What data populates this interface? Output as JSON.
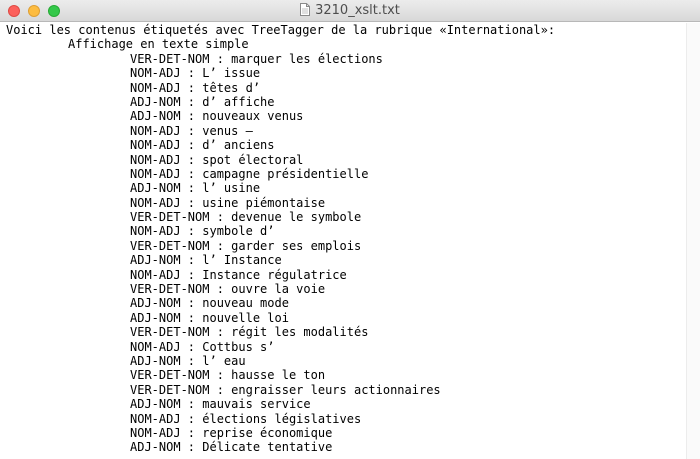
{
  "window": {
    "title": "3210_xslt.txt"
  },
  "document": {
    "intro": "Voici les contenus étiquetés avec TreeTagger de la rubrique «International»:",
    "section_heading": "Affichage en texte simple",
    "entries": [
      "VER-DET-NOM : marquer les élections",
      "NOM-ADJ : L’ issue",
      "NOM-ADJ : têtes d’",
      "ADJ-NOM : d’ affiche",
      "ADJ-NOM : nouveaux venus",
      "NOM-ADJ : venus –",
      "NOM-ADJ : d’ anciens",
      "NOM-ADJ : spot électoral",
      "NOM-ADJ : campagne présidentielle",
      "ADJ-NOM : l’ usine",
      "NOM-ADJ : usine piémontaise",
      "VER-DET-NOM : devenue le symbole",
      "NOM-ADJ : symbole d’",
      "VER-DET-NOM : garder ses emplois",
      "ADJ-NOM : l’ Instance",
      "NOM-ADJ : Instance régulatrice",
      "VER-DET-NOM : ouvre la voie",
      "ADJ-NOM : nouveau mode",
      "ADJ-NOM : nouvelle loi",
      "VER-DET-NOM : régit les modalités",
      "NOM-ADJ : Cottbus s’",
      "ADJ-NOM : l’ eau",
      "VER-DET-NOM : hausse le ton",
      "VER-DET-NOM : engraisser leurs actionnaires",
      "ADJ-NOM : mauvais service",
      "NOM-ADJ : élections législatives",
      "NOM-ADJ : reprise économique",
      "ADJ-NOM : Délicate tentative"
    ]
  },
  "icons": {
    "close": "close-button-icon",
    "minimize": "minimize-button-icon",
    "zoom": "zoom-button-icon",
    "document": "text-document-icon"
  },
  "colors": {
    "close": "#fc605b",
    "minimize": "#fdbc40",
    "zoom": "#34c84a",
    "text": "#000000",
    "background": "#ffffff"
  }
}
